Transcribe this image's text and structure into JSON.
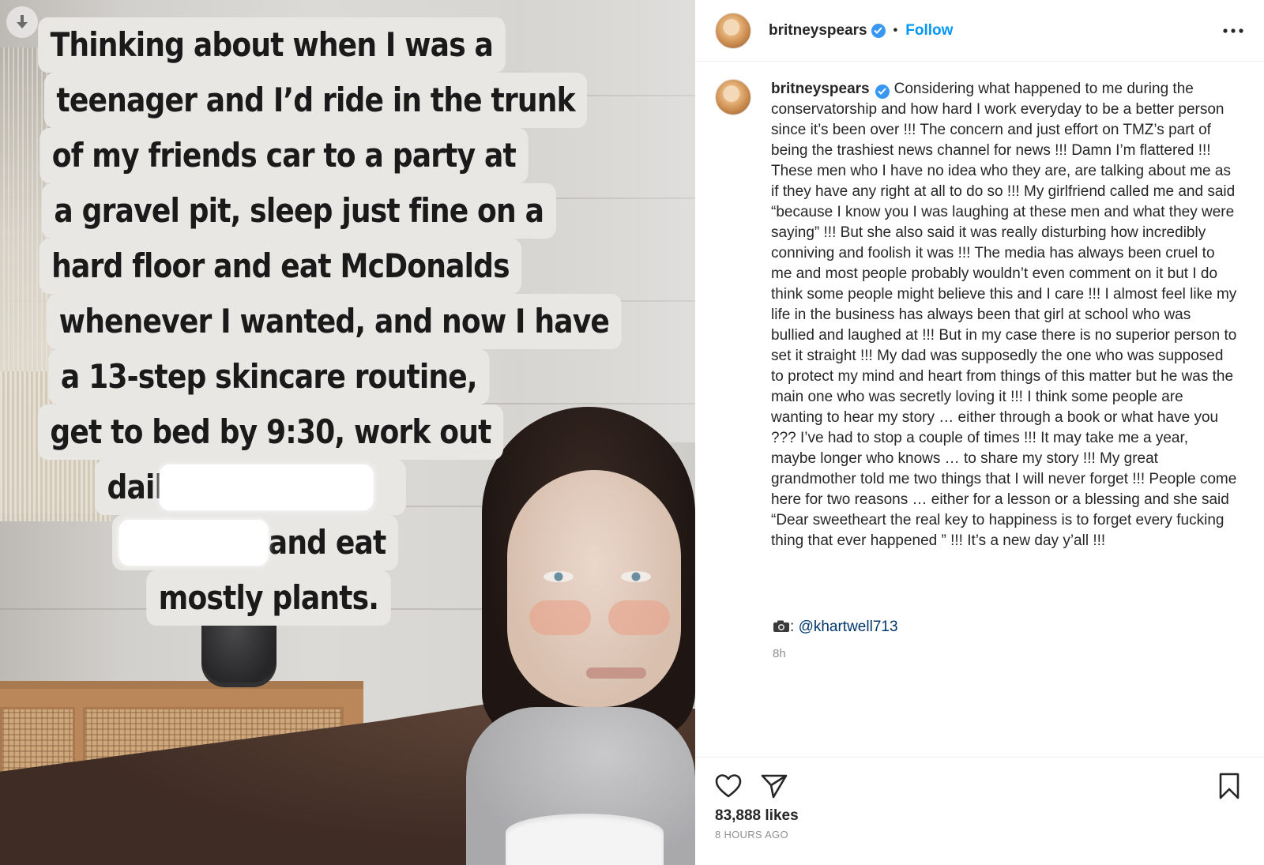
{
  "media": {
    "caption_lines": [
      "Thinking about when I was a",
      "teenager and I’d ride in the trunk",
      "of my friends car to a party at",
      "a gravel pit, sleep just fine on a",
      "hard floor and eat McDonalds",
      "whenever I wanted, and now I have",
      "a 13-step skincare routine,",
      "get to bed by 9:30,  work out",
      "daily",
      "and eat",
      "mostly plants."
    ],
    "download_icon": "download-arrow-icon"
  },
  "post": {
    "username": "britneyspears",
    "verified_icon": "verified-badge-icon",
    "separator": "•",
    "follow_label": "Follow",
    "more_icon": "more-options-icon",
    "caption": "Considering what happened to me during the conservatorship and how hard I work everyday to be a better person since it’s been over !!! The concern and just effort on TMZ’s part of being the trashiest news channel for news !!! Damn I’m flattered !!! These men who I have no idea who they are, are talking about me as if they have any right at all to do so !!! My girlfriend called me and said “because I know you I was laughing at these men and what they were saying” !!! But she also said it was really disturbing how incredibly conniving and foolish it was !!! The media has always been cruel to me and most people probably wouldn’t even comment on it but I do think some people might believe this and I care !!! I almost feel like my life in the business has always been that girl at school who was bullied and laughed at !!! But in my case there is no superior person to set it straight !!! My dad was supposedly the one who was supposed to protect my mind and heart from things of this matter but he was the main one who was secretly loving it !!! I think some people are wanting to hear my story … either through a book or what have you ??? I’ve had to stop a couple of times !!! It may take me a year, maybe longer who knows … to share my story !!! My great grandmother told me two things that I will never forget !!! People come here for two reasons … either for a lesson or a blessing and she said “Dear sweetheart the real key to happiness is to forget every fucking thing that ever happened ” !!! It’s a new day y’all !!!",
    "credit_separator": ":",
    "credit_mention": "@khartwell713",
    "camera_icon": "camera-icon",
    "relative_time": "8h",
    "likes": "83,888 likes",
    "posted_ago": "8 HOURS AGO",
    "like_icon": "heart-icon",
    "share_icon": "send-icon",
    "save_icon": "bookmark-icon"
  },
  "colors": {
    "link_blue": "#0095f6",
    "mention_blue": "#00376b",
    "muted_text": "#8e8e8e"
  }
}
